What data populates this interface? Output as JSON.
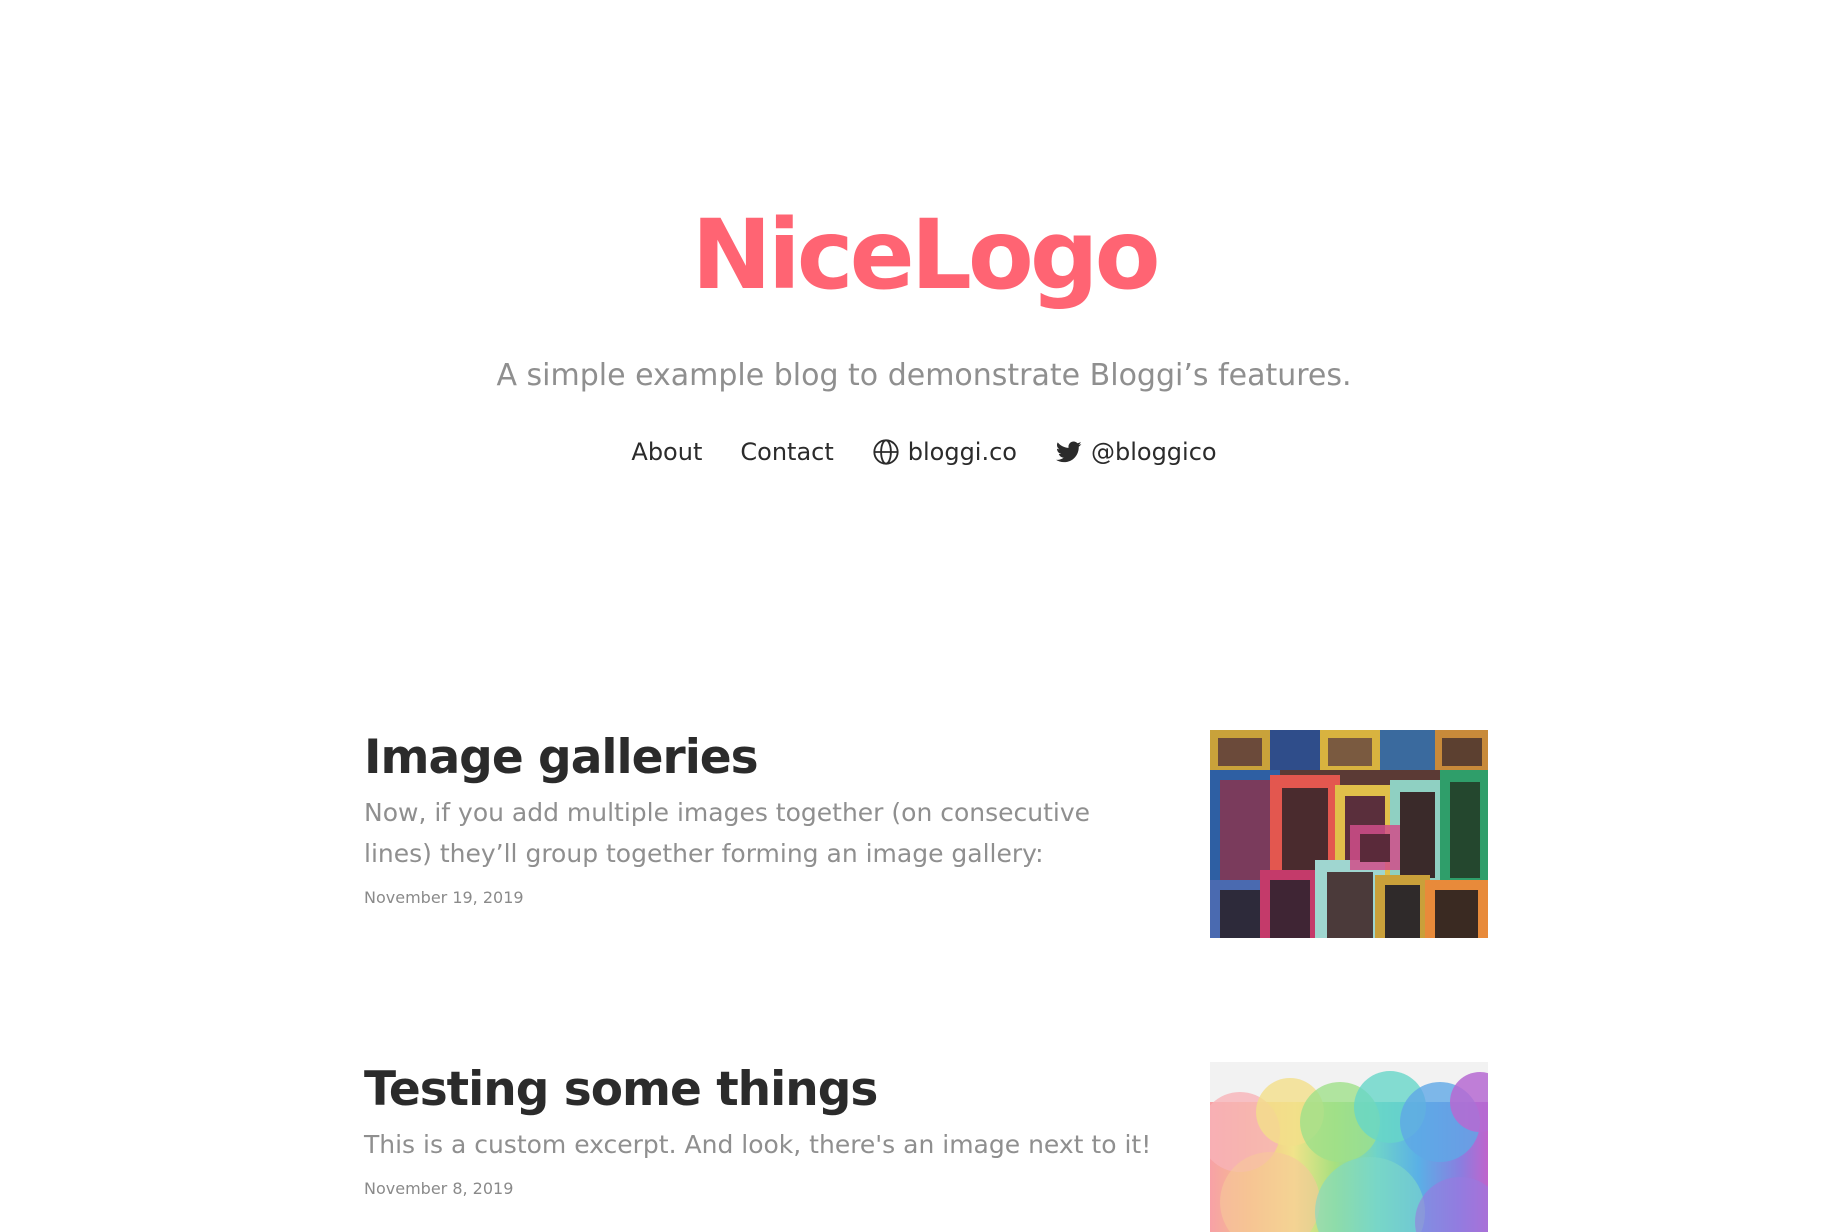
{
  "brand": {
    "logo_text": "NiceLogo",
    "logo_color": "#ff6473",
    "tagline": "A simple example blog to demonstrate Bloggi’s features."
  },
  "nav": {
    "items": [
      {
        "label": "About",
        "icon": ""
      },
      {
        "label": "Contact",
        "icon": ""
      },
      {
        "label": "bloggi.co",
        "icon": "globe-icon"
      },
      {
        "label": "@bloggico",
        "icon": "twitter-icon"
      }
    ]
  },
  "posts": [
    {
      "title": "Image galleries",
      "excerpt": "Now, if you add multiple images together (on consecutive lines) they’ll group together forming an image gallery:",
      "date": "November 19, 2019",
      "thumbnail": "colorful-picture-frames"
    },
    {
      "title": "Testing some things",
      "excerpt": "This is a custom excerpt. And look, there's an image next to it!",
      "date": "November 8, 2019",
      "thumbnail": "rainbow-ink-clouds"
    }
  ]
}
